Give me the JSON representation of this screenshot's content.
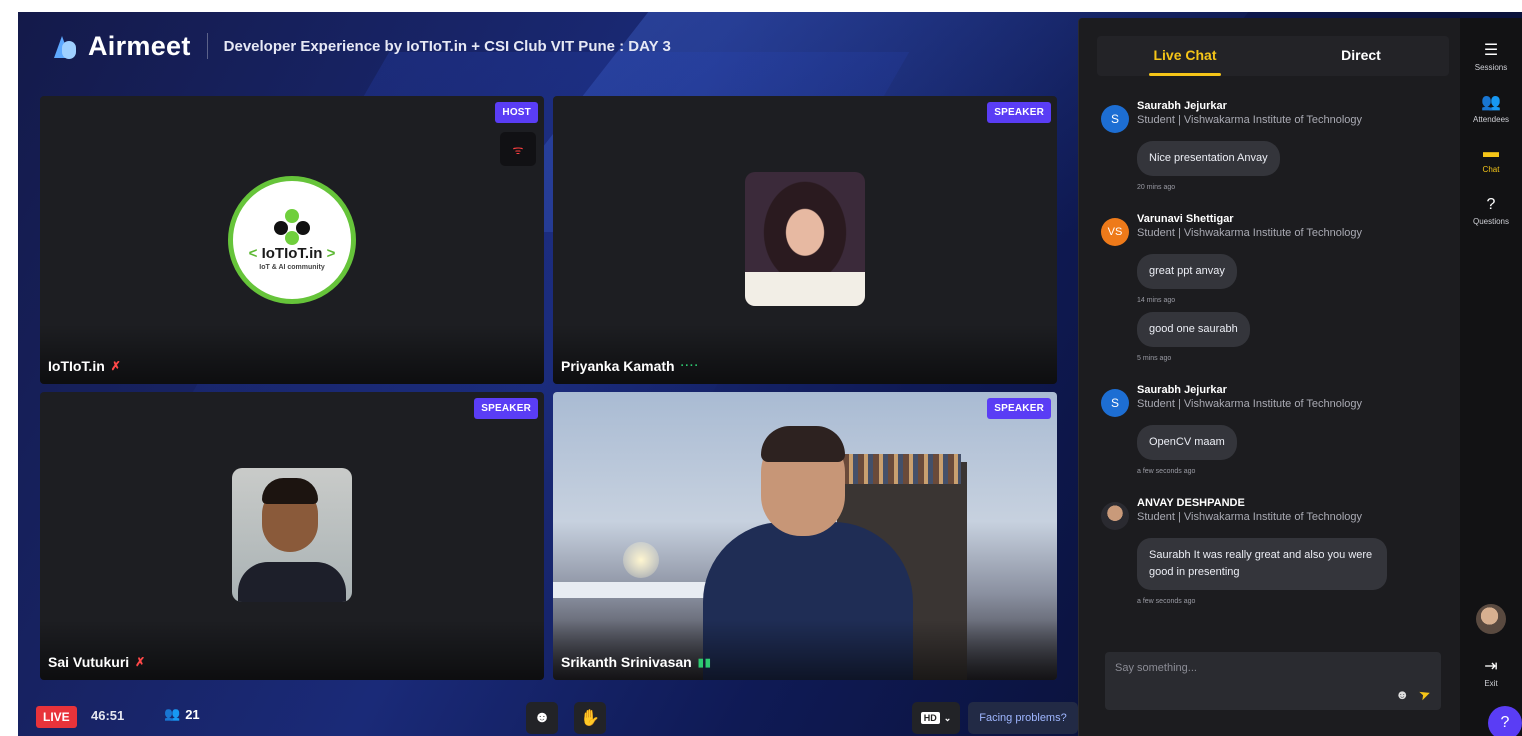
{
  "brand": {
    "name": "Airmeet"
  },
  "event": {
    "title": "Developer Experience by IoTIoT.in + CSI Club VIT Pune : DAY 3"
  },
  "tiles": [
    {
      "name": "IoTIoT.in",
      "role": "HOST",
      "mic": "muted"
    },
    {
      "name": "Priyanka Kamath",
      "role": "SPEAKER",
      "mic": "active"
    },
    {
      "name": "Sai Vutukuri",
      "role": "SPEAKER",
      "mic": "muted"
    },
    {
      "name": "Srikanth Srinivasan",
      "role": "SPEAKER",
      "mic": "active"
    }
  ],
  "host_logo": {
    "name_open": "<",
    "name_mid": " IoTIoT.in ",
    "name_close": ">",
    "tagline": "IoT & AI community"
  },
  "bottom_bar": {
    "live_label": "LIVE",
    "timer": "46:51",
    "attendee_count": "21",
    "hd_label": "HD",
    "problems_label": "Facing problems?"
  },
  "chat": {
    "tabs": [
      {
        "label": "Live Chat",
        "active": true
      },
      {
        "label": "Direct",
        "active": false
      }
    ],
    "messages": [
      {
        "initials": "S",
        "sender": "Saurabh Jejurkar",
        "org": "Student | Vishwakarma Institute of Technology",
        "texts": [
          {
            "text": "Nice presentation Anvay",
            "time": "20 mins ago"
          }
        ]
      },
      {
        "initials": "VS",
        "sender": "Varunavi Shettigar",
        "org": "Student | Vishwakarma Institute of Technology",
        "texts": [
          {
            "text": "great ppt anvay",
            "time": "14 mins ago"
          },
          {
            "text": "good one saurabh",
            "time": "5 mins ago"
          }
        ]
      },
      {
        "initials": "S",
        "sender": "Saurabh Jejurkar",
        "org": "Student | Vishwakarma Institute of Technology",
        "texts": [
          {
            "text": "OpenCV maam",
            "time": "a few seconds ago"
          }
        ]
      },
      {
        "initials": "",
        "sender": "ANVAY DESHPANDE",
        "org": "Student | Vishwakarma Institute of Technology",
        "texts": [
          {
            "text": "Saurabh It was really great and also you were good in presenting",
            "time": "a few seconds ago"
          }
        ]
      }
    ],
    "input_placeholder": "Say something..."
  },
  "rail": {
    "items": [
      {
        "label": "Sessions",
        "icon": "sessions-icon"
      },
      {
        "label": "Attendees",
        "icon": "attendees-icon"
      },
      {
        "label": "Chat",
        "icon": "chat-icon",
        "active": true
      },
      {
        "label": "Questions",
        "icon": "questions-icon"
      }
    ],
    "exit_label": "Exit",
    "help_icon": "help-icon"
  },
  "colors": {
    "accent": "#f5c518",
    "badge": "#5a3df5",
    "live": "#e8333a",
    "mic_off": "#ff4848",
    "mic_on": "#2ecc71"
  }
}
